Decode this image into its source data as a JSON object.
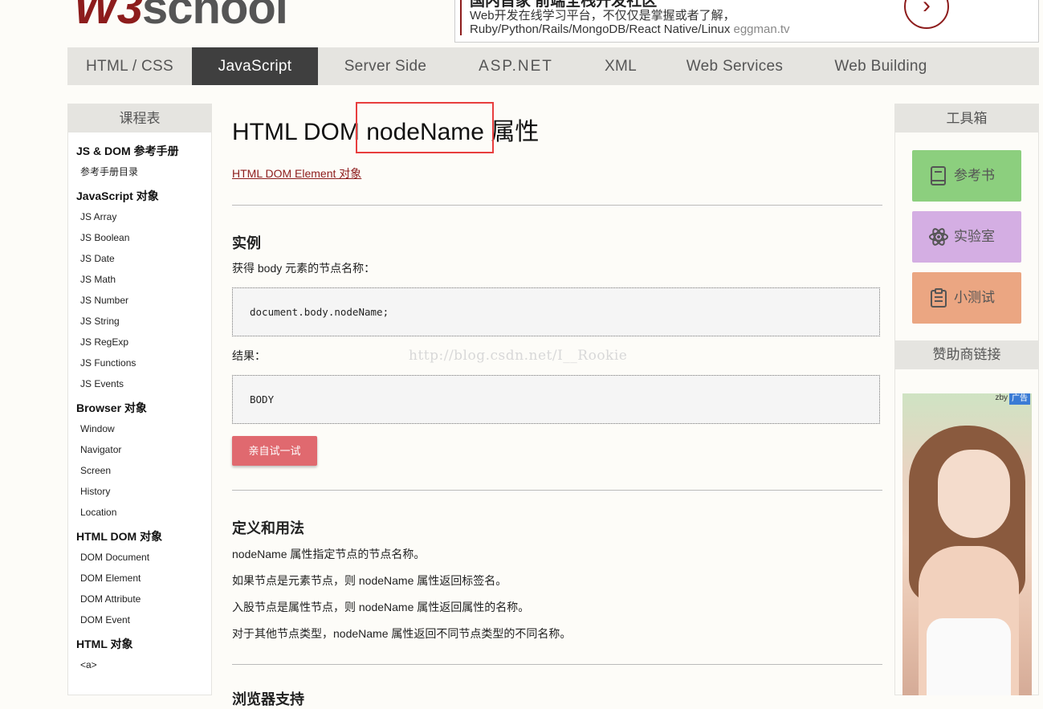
{
  "header": {
    "logo_w3": "W3",
    "logo_school": "school",
    "ad": {
      "line0": "国内首家 前端全栈开发社区",
      "line1": "Web开发在线学习平台，不仅仅是掌握或者了解，",
      "line2": "Ruby/Python/Rails/MongoDB/React Native/Linux",
      "site": "eggman.tv",
      "arrow_icon": "chevron-right-icon"
    }
  },
  "nav": {
    "tabs": [
      {
        "label": "HTML / CSS",
        "active": false
      },
      {
        "label": "JavaScript",
        "active": true
      },
      {
        "label": "Server Side",
        "active": false
      },
      {
        "label": "ASP.NET",
        "active": false
      },
      {
        "label": "XML",
        "active": false
      },
      {
        "label": "Web Services",
        "active": false
      },
      {
        "label": "Web Building",
        "active": false
      }
    ]
  },
  "sidebar_left": {
    "title": "课程表",
    "groups": [
      {
        "title": "JS & DOM 参考手册",
        "items": [
          "参考手册目录"
        ]
      },
      {
        "title": "JavaScript 对象",
        "items": [
          "JS Array",
          "JS Boolean",
          "JS Date",
          "JS Math",
          "JS Number",
          "JS String",
          "JS RegExp",
          "JS Functions",
          "JS Events"
        ]
      },
      {
        "title": "Browser 对象",
        "items": [
          "Window",
          "Navigator",
          "Screen",
          "History",
          "Location"
        ]
      },
      {
        "title": "HTML DOM 对象",
        "items": [
          "DOM Document",
          "DOM Element",
          "DOM Attribute",
          "DOM Event"
        ]
      },
      {
        "title": "HTML 对象",
        "items": [
          "<a>"
        ]
      }
    ]
  },
  "main": {
    "title_prefix": "HTML DOM ",
    "title_highlight": "nodeName",
    "title_suffix": " 属性",
    "back_link": "HTML DOM Element 对象",
    "example_heading": "实例",
    "example_desc": "获得 body 元素的节点名称：",
    "example_code": "document.body.nodeName;",
    "result_label": "结果：",
    "result_value": "BODY",
    "try_button": "亲自试一试",
    "watermark": "http://blog.csdn.net/I__Rookie",
    "definition_heading": "定义和用法",
    "definition_lines": [
      "nodeName 属性指定节点的节点名称。",
      "如果节点是元素节点，则 nodeName 属性返回标签名。",
      "入股节点是属性节点，则 nodeName 属性返回属性的名称。",
      "对于其他节点类型，nodeName 属性返回不同节点类型的不同名称。"
    ],
    "next_heading": "浏览器支持"
  },
  "sidebar_right": {
    "title": "工具箱",
    "tools": [
      {
        "label": "参考书",
        "icon": "book-icon",
        "color": "#8ccf7e"
      },
      {
        "label": "实验室",
        "icon": "atom-icon",
        "color": "#d4aee3"
      },
      {
        "label": "小测试",
        "icon": "clipboard-icon",
        "color": "#eba682"
      }
    ],
    "sponsor_title": "赞助商链接",
    "ad_badge": "广告",
    "ad_zby": "zby"
  }
}
